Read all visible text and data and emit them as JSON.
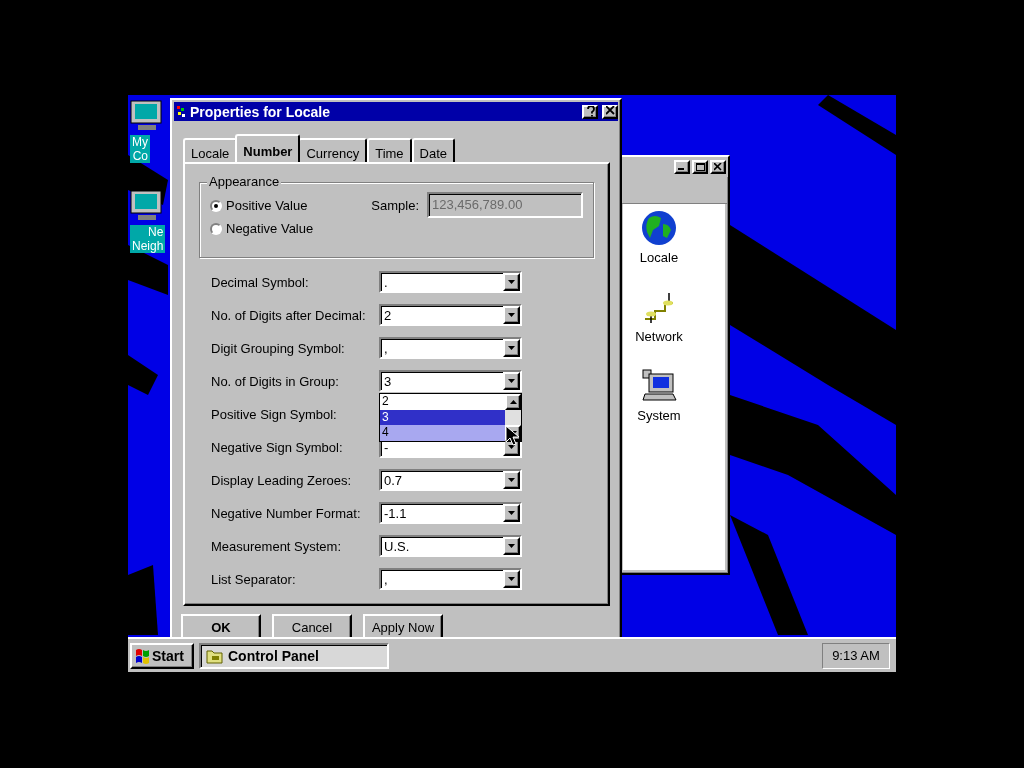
{
  "desktop_icons": [
    {
      "label": "My Co"
    },
    {
      "label": "Ne Neigh"
    }
  ],
  "control_panel": {
    "items": [
      {
        "label": "Locale",
        "kind": "globe"
      },
      {
        "label": "Network",
        "kind": "network"
      },
      {
        "label": "System",
        "kind": "computer"
      }
    ]
  },
  "dialog": {
    "title": "Properties for Locale",
    "tabs": [
      {
        "label": "Locale",
        "selected": false
      },
      {
        "label": "Number",
        "selected": true
      },
      {
        "label": "Currency",
        "selected": false
      },
      {
        "label": "Time",
        "selected": false
      },
      {
        "label": "Date",
        "selected": false
      }
    ],
    "appearance": {
      "title": "Appearance",
      "sample_label": "Sample:",
      "sample_value": "123,456,789.00",
      "options": [
        {
          "label": "Positive Value",
          "selected": true
        },
        {
          "label": "Negative Value",
          "selected": false
        }
      ]
    },
    "fields": [
      {
        "label": "Decimal Symbol:",
        "value": "."
      },
      {
        "label": "No. of Digits after Decimal:",
        "value": "2"
      },
      {
        "label": "Digit Grouping Symbol:",
        "value": ","
      },
      {
        "label": "No. of Digits in Group:",
        "value": "3",
        "open": true,
        "options": [
          {
            "label": "2",
            "selected": false,
            "hover": false
          },
          {
            "label": "3",
            "selected": true,
            "hover": false
          },
          {
            "label": "4",
            "selected": false,
            "hover": true
          }
        ]
      },
      {
        "label": "Positive Sign Symbol:"
      },
      {
        "label": "Negative Sign Symbol:",
        "value": "-"
      },
      {
        "label": "Display Leading Zeroes:",
        "value": "0.7"
      },
      {
        "label": "Negative Number Format:",
        "value": "-1.1"
      },
      {
        "label": "Measurement System:",
        "value": "U.S."
      },
      {
        "label": "List Separator:",
        "value": ","
      }
    ],
    "buttons": [
      "OK",
      "Cancel",
      "Apply Now"
    ]
  },
  "taskbar": {
    "start": "Start",
    "tasks": [
      {
        "label": "Control Panel"
      }
    ],
    "clock": "9:13 AM"
  }
}
